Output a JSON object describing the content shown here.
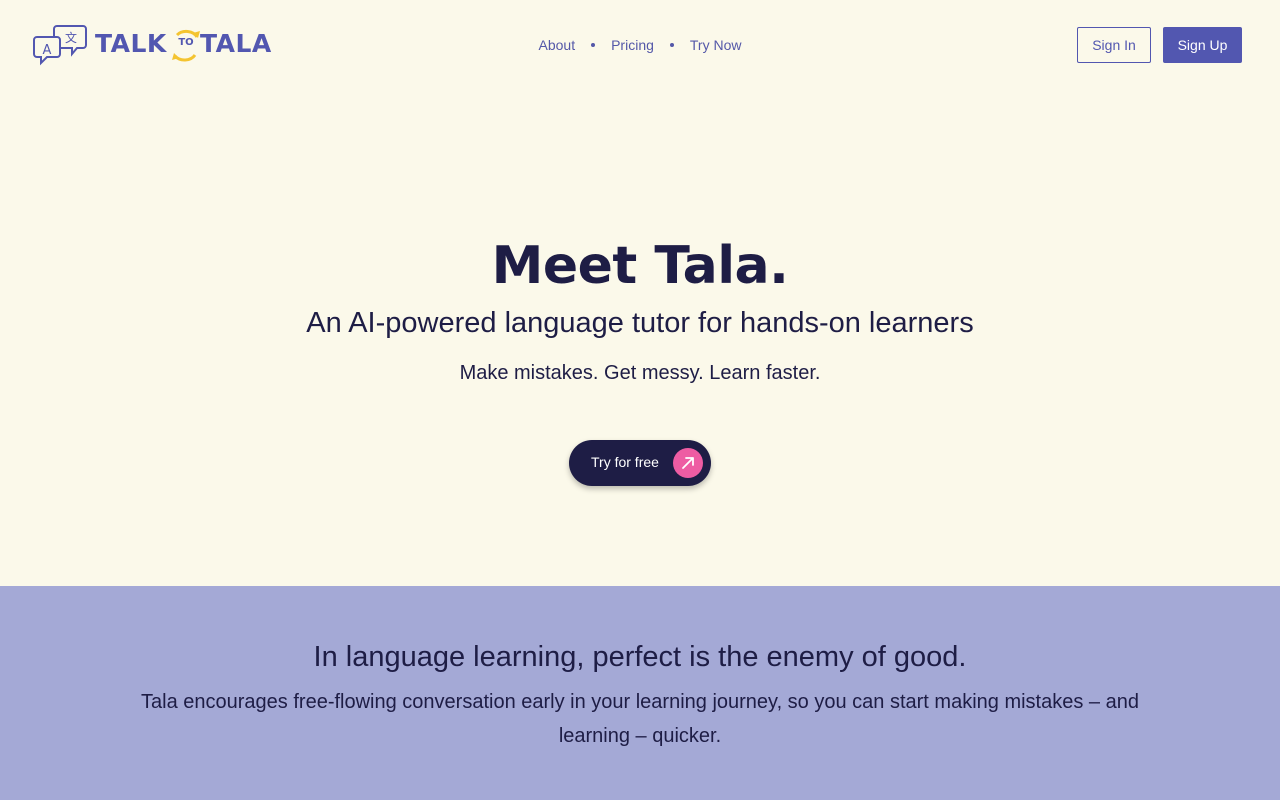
{
  "header": {
    "logo": {
      "word_left": "TALK",
      "word_middle": "TO",
      "word_right": "TALA",
      "glyph_latin": "A",
      "glyph_translate": "文"
    },
    "nav": [
      {
        "label": "About"
      },
      {
        "label": "Pricing"
      },
      {
        "label": "Try Now"
      }
    ],
    "sign_in_label": "Sign In",
    "sign_up_label": "Sign Up"
  },
  "hero": {
    "title": "Meet Tala.",
    "subtitle": "An AI-powered language tutor for hands-on learners",
    "tagline": "Make mistakes. Get messy. Learn faster.",
    "cta_label": "Try for free",
    "cta_icon": "arrow-up-right-icon"
  },
  "section": {
    "title": "In language learning, perfect is the enemy of good.",
    "body": "Tala encourages free-flowing conversation early in your learning journey, so you can start making mistakes – and learning – quicker."
  },
  "colors": {
    "background": "#fbf9ea",
    "brand": "#5257b0",
    "dark": "#1e1d45",
    "accent_pink": "#ee5ca3",
    "accent_yellow": "#f4c430",
    "section_bg": "#a4a9d6"
  }
}
